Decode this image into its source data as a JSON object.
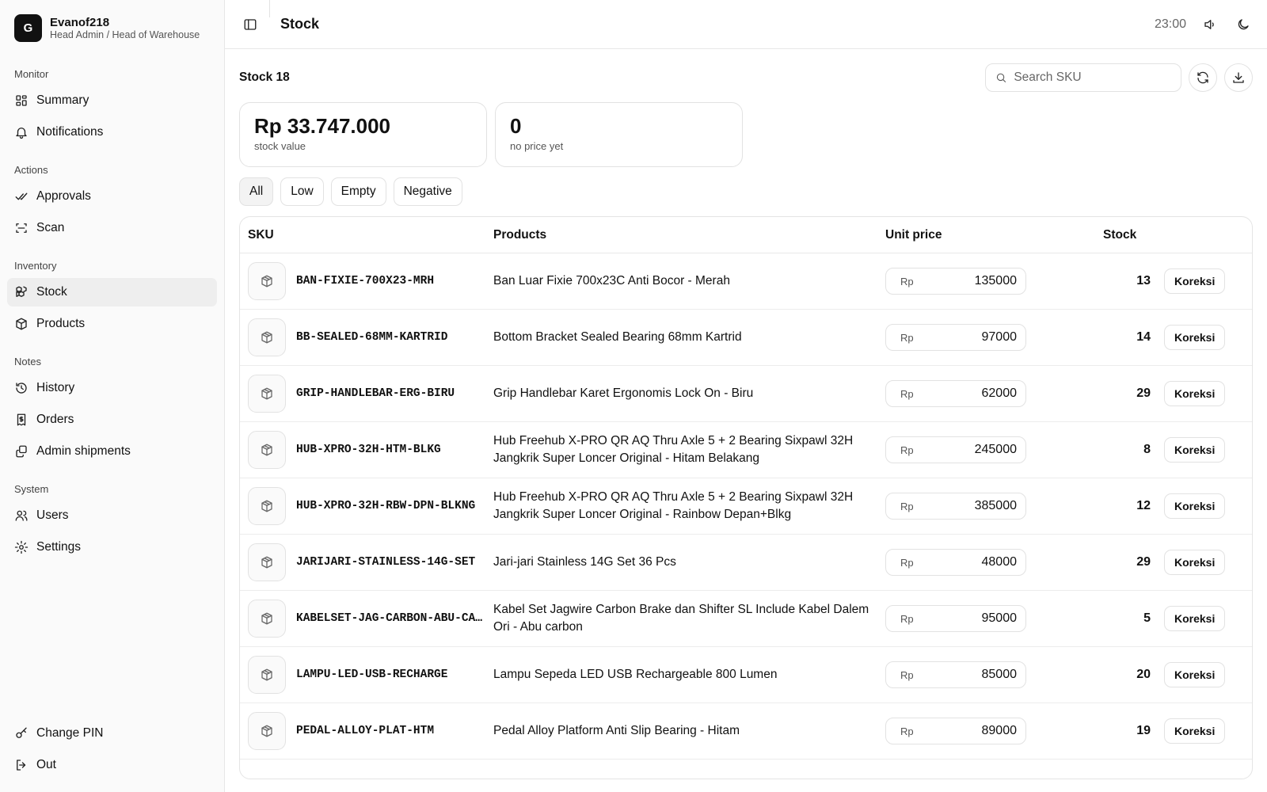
{
  "user": {
    "initial": "G",
    "name": "Evanof218",
    "role": "Head Admin / Head of Warehouse"
  },
  "nav": {
    "groups": [
      {
        "label": "Monitor",
        "items": [
          {
            "label": "Summary",
            "icon": "dashboard-icon"
          },
          {
            "label": "Notifications",
            "icon": "bell-icon"
          }
        ]
      },
      {
        "label": "Actions",
        "items": [
          {
            "label": "Approvals",
            "icon": "double-check-icon"
          },
          {
            "label": "Scan",
            "icon": "scan-icon"
          }
        ]
      },
      {
        "label": "Inventory",
        "items": [
          {
            "label": "Stock",
            "icon": "boxes-icon",
            "active": true
          },
          {
            "label": "Products",
            "icon": "package-icon"
          }
        ]
      },
      {
        "label": "Notes",
        "items": [
          {
            "label": "History",
            "icon": "history-icon"
          },
          {
            "label": "Orders",
            "icon": "receipt-icon"
          },
          {
            "label": "Admin shipments",
            "icon": "copy-icon"
          }
        ]
      },
      {
        "label": "System",
        "items": [
          {
            "label": "Users",
            "icon": "users-icon"
          },
          {
            "label": "Settings",
            "icon": "gear-icon"
          }
        ]
      }
    ],
    "footer": [
      {
        "label": "Change PIN",
        "icon": "key-icon"
      },
      {
        "label": "Out",
        "icon": "logout-icon"
      }
    ]
  },
  "header": {
    "title": "Stock",
    "time": "23:00"
  },
  "toolbar": {
    "count_label": "Stock 18",
    "search_placeholder": "Search SKU"
  },
  "stats": {
    "stock_value": "Rp 33.747.000",
    "stock_value_label": "stock value",
    "no_price": "0",
    "no_price_label": "no price yet"
  },
  "filters": [
    "All",
    "Low",
    "Empty",
    "Negative"
  ],
  "table": {
    "headers": {
      "sku": "SKU",
      "products": "Products",
      "unit_price": "Unit price",
      "stock": "Stock"
    },
    "currency": "Rp",
    "action_label": "Koreksi",
    "rows": [
      {
        "sku": "BAN-FIXIE-700X23-MRH",
        "product": "Ban Luar Fixie 700x23C Anti Bocor - Merah",
        "price": "135000",
        "stock": "13"
      },
      {
        "sku": "BB-SEALED-68MM-KARTRID",
        "product": "Bottom Bracket Sealed Bearing 68mm Kartrid",
        "price": "97000",
        "stock": "14"
      },
      {
        "sku": "GRIP-HANDLEBAR-ERG-BIRU",
        "product": "Grip Handlebar Karet Ergonomis Lock On - Biru",
        "price": "62000",
        "stock": "29"
      },
      {
        "sku": "HUB-XPRO-32H-HTM-BLKG",
        "product": "Hub Freehub X-PRO QR AQ Thru Axle 5 + 2 Bearing Sixpawl 32H Jangkrik Super Loncer Original - Hitam Belakang",
        "price": "245000",
        "stock": "8"
      },
      {
        "sku": "HUB-XPRO-32H-RBW-DPN-BLKNG",
        "product": "Hub Freehub X-PRO QR AQ Thru Axle 5 + 2 Bearing Sixpawl 32H Jangkrik Super Loncer Original - Rainbow Depan+Blkg",
        "price": "385000",
        "stock": "12"
      },
      {
        "sku": "JARIJARI-STAINLESS-14G-SET",
        "product": "Jari-jari Stainless 14G Set 36 Pcs",
        "price": "48000",
        "stock": "29"
      },
      {
        "sku": "KABELSET-JAG-CARBON-ABU-CARBON",
        "product": "Kabel Set Jagwire Carbon Brake dan Shifter SL Include Kabel Dalem Ori - Abu carbon",
        "price": "95000",
        "stock": "5"
      },
      {
        "sku": "LAMPU-LED-USB-RECHARGE",
        "product": "Lampu Sepeda LED USB Rechargeable 800 Lumen",
        "price": "85000",
        "stock": "20"
      },
      {
        "sku": "PEDAL-ALLOY-PLAT-HTM",
        "product": "Pedal Alloy Platform Anti Slip Bearing - Hitam",
        "price": "89000",
        "stock": "19"
      }
    ]
  }
}
